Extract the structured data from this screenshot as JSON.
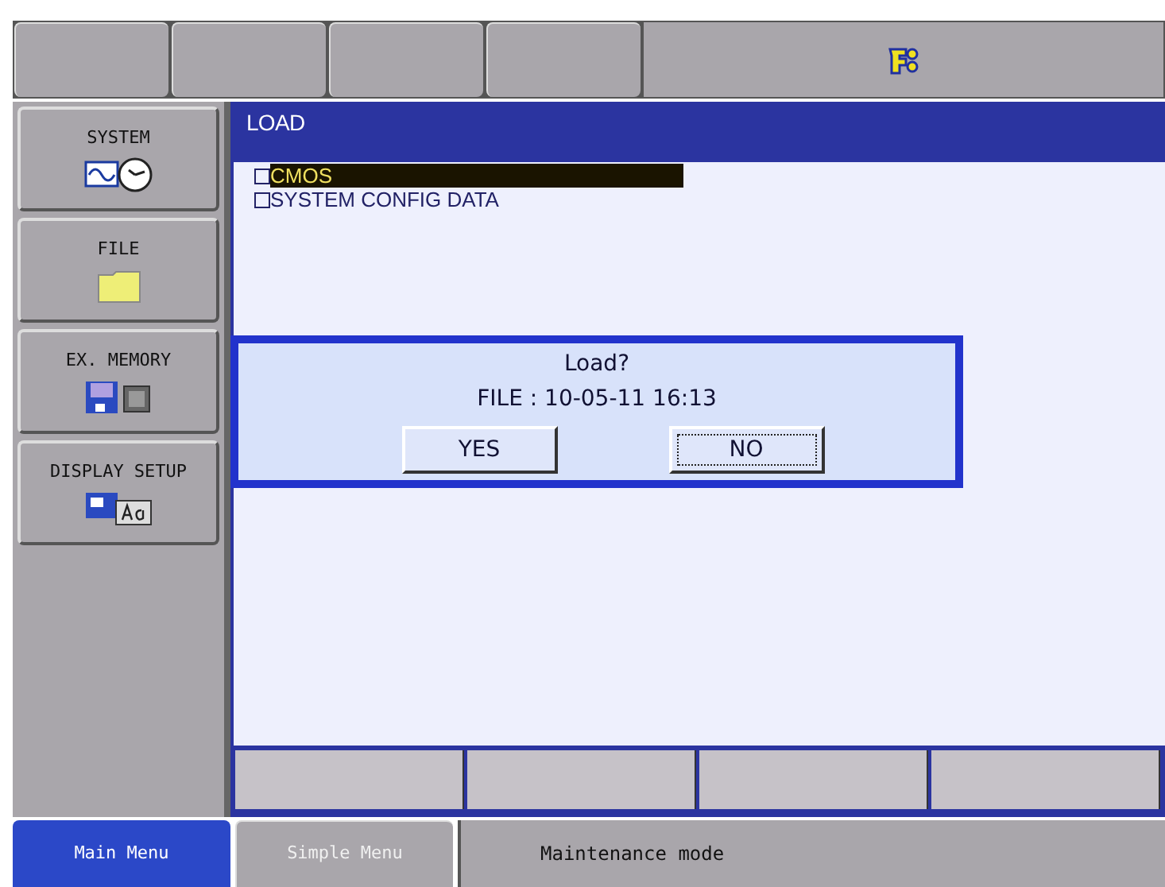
{
  "side_menu": [
    {
      "label": "SYSTEM",
      "kind": "system"
    },
    {
      "label": "FILE",
      "kind": "file"
    },
    {
      "label": "EX. MEMORY",
      "kind": "memory"
    },
    {
      "label": "DISPLAY SETUP",
      "kind": "display"
    }
  ],
  "window": {
    "title": "LOAD"
  },
  "items": [
    {
      "label": "CMOS",
      "checked": false,
      "selected": true
    },
    {
      "label": "SYSTEM CONFIG DATA",
      "checked": false,
      "selected": false
    }
  ],
  "dialog": {
    "title": "Load?",
    "message": "FILE : 10-05-11 16:13",
    "buttons": [
      {
        "label": "YES",
        "selected": false
      },
      {
        "label": "NO",
        "selected": true
      }
    ]
  },
  "bottom_tabs": [
    {
      "label": "Main Menu",
      "selected": true
    },
    {
      "label": "Simple Menu",
      "selected": false
    }
  ],
  "status_bar": "Maintenance mode"
}
